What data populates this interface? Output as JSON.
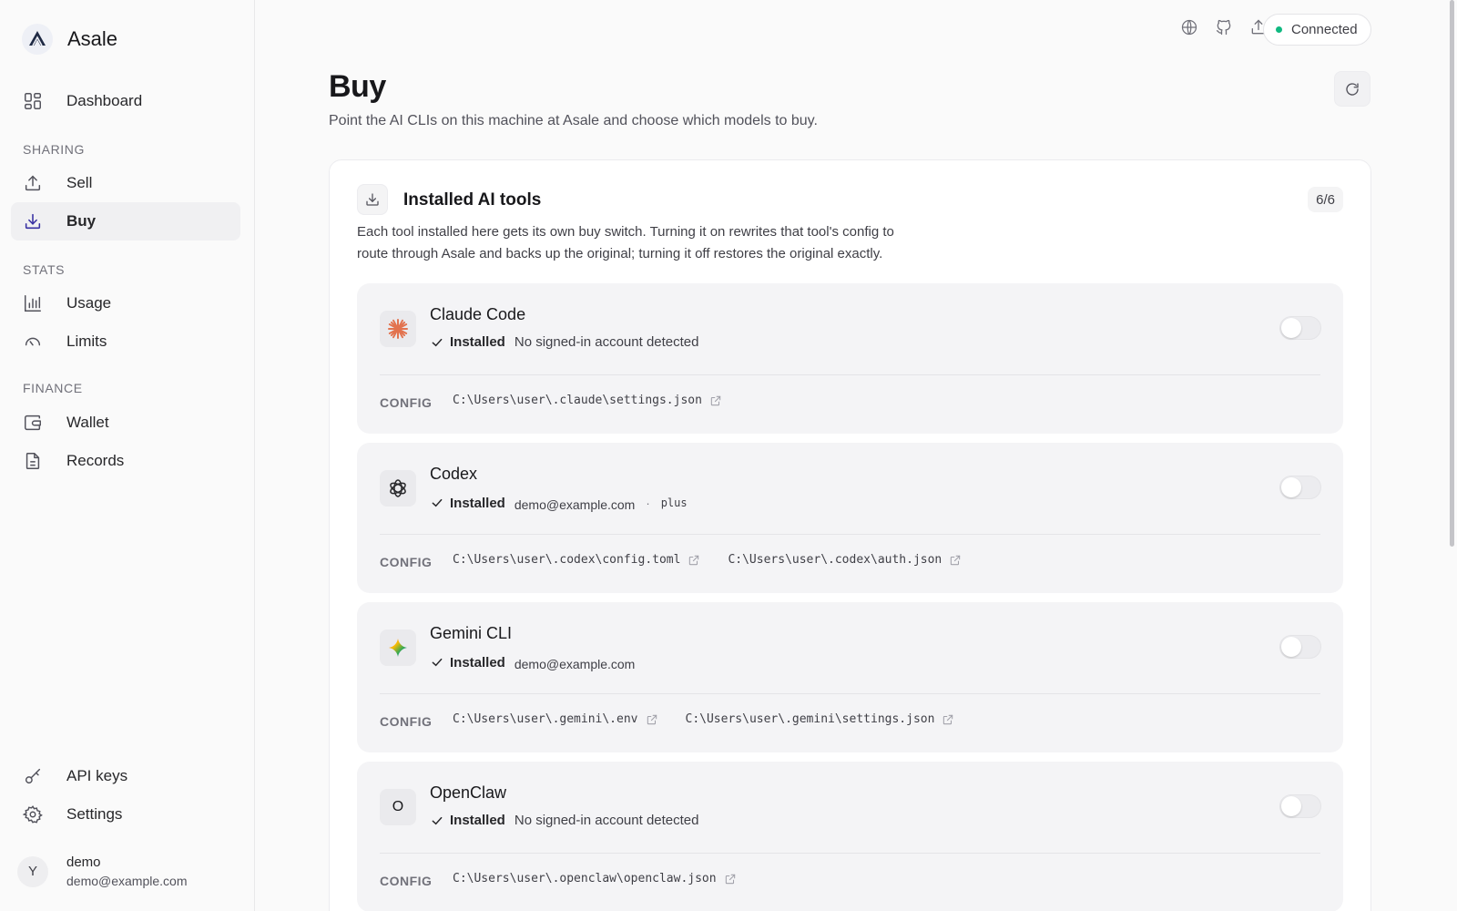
{
  "app": {
    "name": "Asale"
  },
  "sidebar": {
    "dashboard": "Dashboard",
    "sections": {
      "sharing": "SHARING",
      "stats": "STATS",
      "finance": "FINANCE"
    },
    "items": {
      "sell": "Sell",
      "buy": "Buy",
      "usage": "Usage",
      "limits": "Limits",
      "wallet": "Wallet",
      "records": "Records",
      "api_keys": "API keys",
      "settings": "Settings"
    },
    "user": {
      "initial": "Y",
      "name": "demo",
      "email": "demo@example.com"
    }
  },
  "topbar": {
    "status": "Connected",
    "status_color": "#10b981"
  },
  "page": {
    "title": "Buy",
    "subtitle": "Point the AI CLIs on this machine at Asale and choose which models to buy."
  },
  "card": {
    "title": "Installed AI tools",
    "count": "6/6",
    "description": "Each tool installed here gets its own buy switch. Turning it on rewrites that tool's config to route through Asale and backs up the original; turning it off restores the original exactly."
  },
  "config_label": "CONFIG",
  "tools": [
    {
      "name": "Claude Code",
      "installed": "Installed",
      "detail": "No signed-in account detected",
      "config": [
        "C:\\Users\\user\\.claude\\settings.json"
      ],
      "enabled": false
    },
    {
      "name": "Codex",
      "installed": "Installed",
      "email": "demo@example.com",
      "separator": "·",
      "plan": "plus",
      "config": [
        "C:\\Users\\user\\.codex\\config.toml",
        "C:\\Users\\user\\.codex\\auth.json"
      ],
      "enabled": false
    },
    {
      "name": "Gemini CLI",
      "installed": "Installed",
      "email": "demo@example.com",
      "config": [
        "C:\\Users\\user\\.gemini\\.env",
        "C:\\Users\\user\\.gemini\\settings.json"
      ],
      "enabled": false
    },
    {
      "name": "OpenClaw",
      "icon_letter": "O",
      "installed": "Installed",
      "detail": "No signed-in account detected",
      "config": [
        "C:\\Users\\user\\.openclaw\\openclaw.json"
      ],
      "enabled": false
    }
  ],
  "colors": {
    "claude": "#e2734f",
    "accent_dark": "#18181b"
  }
}
